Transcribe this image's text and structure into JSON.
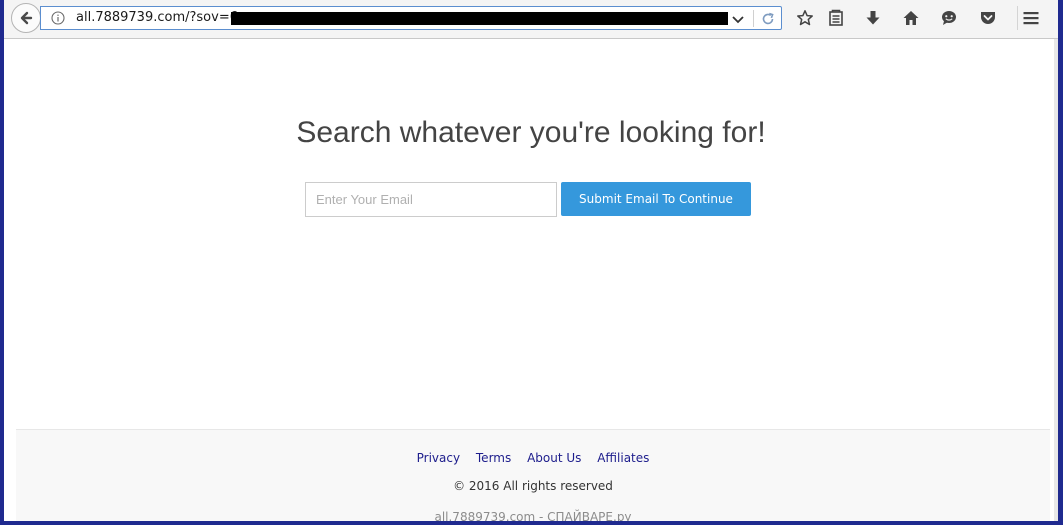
{
  "browser": {
    "url": "all.7889739.com/?sov=6",
    "icons": {
      "back": "back-arrow-icon",
      "info": "info-icon",
      "dropdown": "chevron-down-icon",
      "reload": "reload-icon",
      "bookmark": "star-icon",
      "reader": "reading-list-icon",
      "download": "download-icon",
      "home": "home-icon",
      "chat": "chat-icon",
      "pocket": "pocket-icon",
      "menu": "hamburger-menu-icon"
    }
  },
  "main": {
    "headline": "Search whatever you're looking for!",
    "email_placeholder": "Enter Your Email",
    "email_value": "",
    "submit_label": "Submit Email To Continue"
  },
  "footer": {
    "links": [
      "Privacy",
      "Terms",
      "About Us",
      "Affiliates"
    ],
    "copyright": "© 2016 All rights reserved",
    "watermark": "all.7889739.com - СПАЙВАРЕ.ру"
  },
  "colors": {
    "accent": "#3598dc",
    "link": "#1d1d8c",
    "headline": "#444444",
    "desktop_bg": "#1f2a8f"
  }
}
